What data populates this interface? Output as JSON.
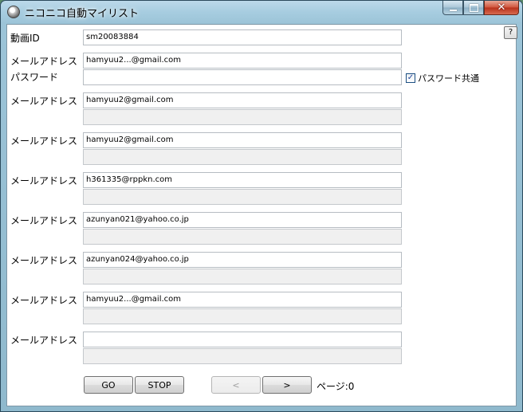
{
  "window": {
    "title": "ニコニコ自動マイリスト"
  },
  "video": {
    "label": "動画ID",
    "value": "sm20083884"
  },
  "account_label": "メールアドレス",
  "main_account": {
    "email": "hamyuu2...@gmail.com",
    "password_label": "パスワード",
    "password": ""
  },
  "password_shared": {
    "label": "パスワード共通",
    "checked": true,
    "mark": "✓"
  },
  "accounts": [
    {
      "email": "hamyuu2@gmail.com",
      "password": ""
    },
    {
      "email": "hamyuu2@gmail.com",
      "password": ""
    },
    {
      "email": "h361335@rppkn.com",
      "password": ""
    },
    {
      "email": "azunyan021@yahoo.co.jp",
      "password": ""
    },
    {
      "email": "azunyan024@yahoo.co.jp",
      "password": ""
    },
    {
      "email": "hamyuu2...@gmail.com",
      "password": ""
    },
    {
      "email": "",
      "password": ""
    }
  ],
  "buttons": {
    "go": "GO",
    "stop": "STOP",
    "prev": "<",
    "next": ">",
    "help": "?"
  },
  "page": {
    "text": "ページ:0"
  },
  "colors": {
    "close_button": "#c8402a",
    "title_gradient_top": "#bcd9ea",
    "disabled_text": "#a0a0a0"
  },
  "icons": {
    "app": "niconico-icon",
    "check": "check-icon"
  }
}
